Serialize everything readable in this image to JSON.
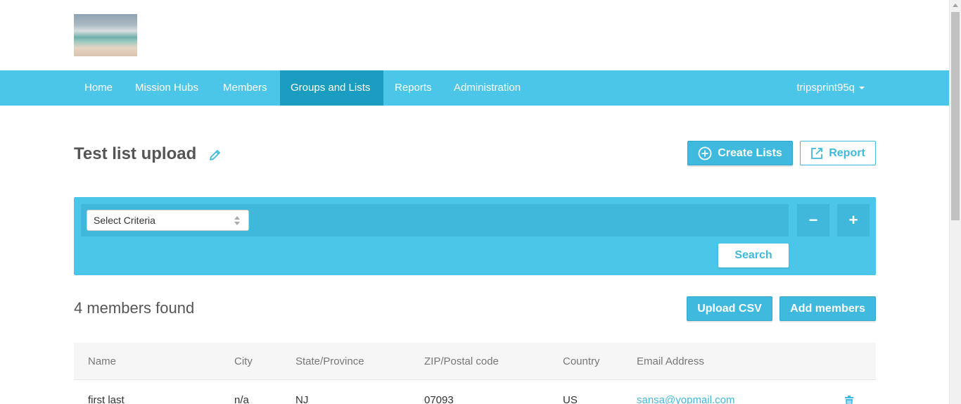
{
  "nav": {
    "items": [
      {
        "label": "Home"
      },
      {
        "label": "Mission Hubs"
      },
      {
        "label": "Members"
      },
      {
        "label": "Groups and Lists"
      },
      {
        "label": "Reports"
      },
      {
        "label": "Administration"
      }
    ],
    "active": "Groups and Lists",
    "user": "tripsprint95q"
  },
  "page": {
    "title": "Test list upload",
    "create_lists_label": "Create Lists",
    "report_label": "Report"
  },
  "filter": {
    "select_value": "Select Criteria",
    "minus_label": "−",
    "plus_label": "+",
    "search_label": "Search"
  },
  "results": {
    "count_text": "4 members found",
    "upload_label": "Upload CSV",
    "add_label": "Add members"
  },
  "table": {
    "headers": [
      "Name",
      "City",
      "State/Province",
      "ZIP/Postal code",
      "Country",
      "Email Address"
    ],
    "rows": [
      {
        "name": "first last",
        "city": "n/a",
        "state": "NJ",
        "zip": "07093",
        "country": "US",
        "email": "sansa@yopmail.com"
      }
    ]
  },
  "colors": {
    "accent": "#4bc5e8",
    "active_nav": "#1a9dc0",
    "button": "#3fb9dd"
  }
}
